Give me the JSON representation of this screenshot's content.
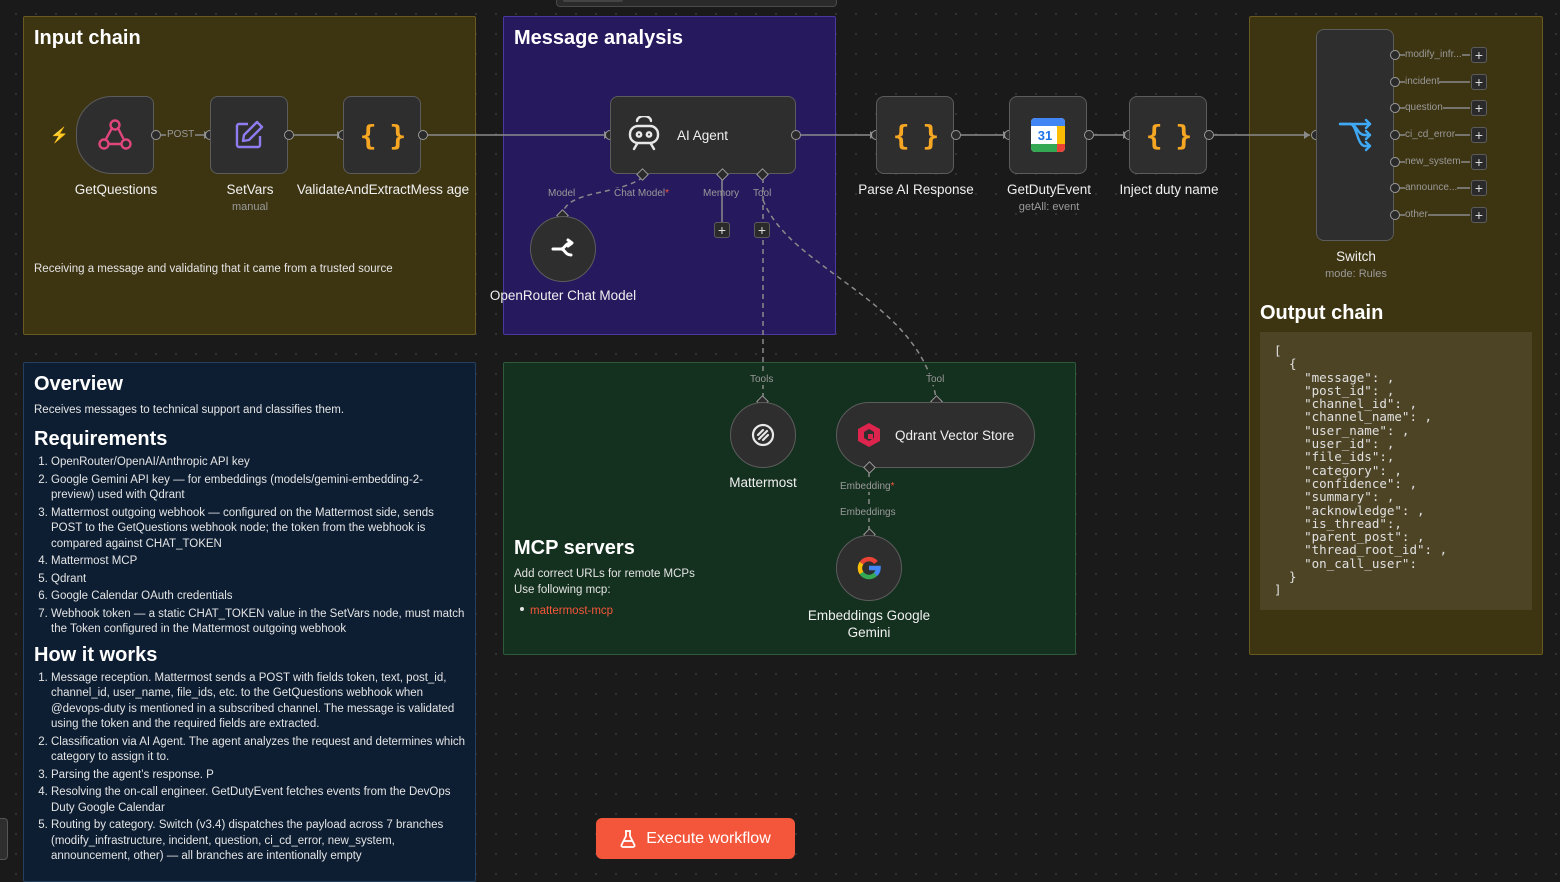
{
  "top_tabs": [
    "",
    ""
  ],
  "sticky_notes": {
    "input_chain": {
      "title": "Input chain",
      "text": "Receiving a message and validating that it came from a trusted source"
    },
    "message_analysis": {
      "title": "Message analysis"
    },
    "output_chain": {
      "title": "Output chain",
      "code": "[\n  {\n    \"message\": ,\n    \"post_id\": ,\n    \"channel_id\": ,\n    \"channel_name\": ,\n    \"user_name\": ,\n    \"user_id\": ,\n    \"file_ids\":,\n    \"category\": ,\n    \"confidence\": ,\n    \"summary\": ,\n    \"acknowledge\": ,\n    \"is_thread\":,\n    \"parent_post\": ,\n    \"thread_root_id\": ,\n    \"on_call_user\":\n  }\n]"
    },
    "mcp_servers": {
      "title": "MCP servers",
      "line1": "Add correct URLs for remote MCPs",
      "line2": "Use following mcp:",
      "link": "mattermost-mcp"
    },
    "overview": {
      "title": "Overview",
      "text": "Receives messages to technical support and classifies them.",
      "req_title": "Requirements",
      "requirements": [
        "OpenRouter/OpenAI/Anthropic API key",
        "Google Gemini API key — for embeddings (models/gemini-embedding-2-preview) used with Qdrant",
        "Mattermost outgoing webhook — configured on the Mattermost side, sends POST to the GetQuestions webhook node; the token from the webhook is compared against CHAT_TOKEN",
        "Mattermost MCP",
        "Qdrant",
        "Google Calendar OAuth credentials",
        "Webhook token — a static CHAT_TOKEN value in the SetVars node, must match the Token configured in the Mattermost outgoing webhook"
      ],
      "how_title": "How it works",
      "how": [
        "Message reception. Mattermost sends a POST with fields token, text, post_id, channel_id, user_name, file_ids, etc. to the GetQuestions webhook when @devops-duty is mentioned in a subscribed channel. The message is validated using the token and the required fields are extracted.",
        "Classification via AI Agent. The agent analyzes the request and determines which category to assign it to.",
        "Parsing the agent’s response. P",
        "Resolving the on-call engineer. GetDutyEvent fetches events from the DevOps Duty Google Calendar",
        "Routing by category. Switch (v3.4) dispatches the payload across 7 branches (modify_infrastructure, incident, question, ci_cd_error, new_system, announcement, other) — all branches are intentionally empty"
      ]
    }
  },
  "nodes": {
    "get_questions": {
      "label": "GetQuestions",
      "edge": "POST"
    },
    "set_vars": {
      "label": "SetVars",
      "sub": "manual"
    },
    "validate": {
      "label": "ValidateAndExtractMess age"
    },
    "ai_agent": {
      "label": "AI Agent",
      "ports": [
        "Model",
        "Chat Model",
        "Memory",
        "Tool"
      ]
    },
    "openrouter": {
      "label": "OpenRouter Chat Model"
    },
    "parse": {
      "label": "Parse AI Response"
    },
    "get_duty": {
      "label": "GetDutyEvent",
      "sub": "getAll: event",
      "day": "31"
    },
    "inject": {
      "label": "Inject duty name"
    },
    "switch": {
      "label": "Switch",
      "sub": "mode: Rules",
      "outputs": [
        "modify_infr...",
        "incident",
        "question",
        "ci_cd_error",
        "new_system",
        "announce...",
        "other"
      ]
    },
    "mattermost": {
      "label": "Mattermost",
      "port": "Tools"
    },
    "qdrant": {
      "label": "Qdrant Vector Store",
      "port": "Tool",
      "embedding": "Embedding",
      "embeddings": "Embeddings"
    },
    "gemini": {
      "label": "Embeddings Google Gemini"
    }
  },
  "execute_button": {
    "label": "Execute workflow"
  },
  "colors": {
    "accent": "#f4563b",
    "yellow_note": "#3d3411",
    "purple_note": "#27195e",
    "green_note": "#14301e",
    "navy_note": "#0d1e33"
  }
}
